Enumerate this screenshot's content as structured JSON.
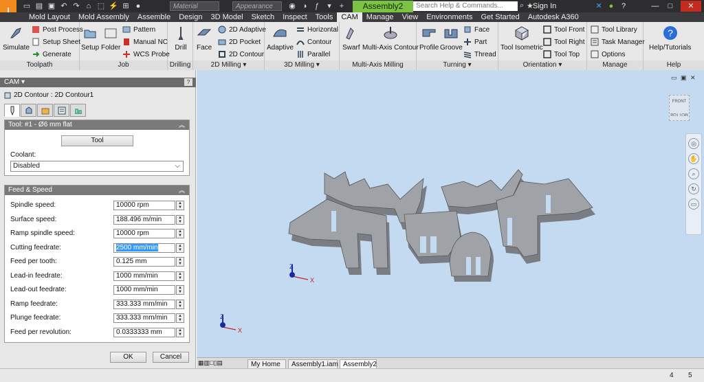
{
  "titlebar": {
    "material_placeholder": "Material",
    "appearance_placeholder": "Appearance",
    "doc_title": "Assembly2",
    "search_placeholder": "Search Help & Commands...",
    "signin": "Sign In",
    "logo_letter": "I",
    "logo_pro": "PRO"
  },
  "tabs": [
    "Mold Layout",
    "Mold Assembly",
    "Assemble",
    "Design",
    "3D Model",
    "Sketch",
    "Inspect",
    "Tools",
    "CAM",
    "Manage",
    "View",
    "Environments",
    "Get Started",
    "Autodesk A360"
  ],
  "active_tab": "CAM",
  "ribbon": {
    "toolpath": {
      "title": "Toolpath",
      "simulate": "Simulate",
      "post_process": "Post Process",
      "setup_sheet": "Setup Sheet",
      "generate": "Generate"
    },
    "job": {
      "title": "Job",
      "setup": "Setup",
      "folder": "Folder",
      "pattern": "Pattern",
      "manual_nc": "Manual NC",
      "wcs_probe": "WCS Probe"
    },
    "drilling": {
      "title": "Drilling",
      "drill": "Drill"
    },
    "milling2d": {
      "title": "2D Milling",
      "face": "Face",
      "adaptive2d": "2D Adaptive",
      "pocket2d": "2D Pocket",
      "contour2d": "2D Contour"
    },
    "milling3d": {
      "title": "3D Milling",
      "adaptive": "Adaptive",
      "horizontal": "Horizontal",
      "contour": "Contour",
      "parallel": "Parallel"
    },
    "multiaxis": {
      "title": "Multi-Axis Milling",
      "swarf": "Swarf",
      "multi_axis_contour": "Multi-Axis Contour"
    },
    "turning": {
      "title": "Turning",
      "profile": "Profile",
      "groove": "Groove",
      "face": "Face",
      "part": "Part",
      "thread": "Thread"
    },
    "orientation": {
      "title": "Orientation",
      "tool_isometric": "Tool Isometric",
      "tool_front": "Tool Front",
      "tool_right": "Tool Right",
      "tool_top": "Tool Top"
    },
    "manage": {
      "title": "Manage",
      "tool_library": "Tool Library",
      "task_manager": "Task Manager",
      "options": "Options"
    },
    "help": {
      "title": "Help",
      "help_tutorials": "Help/Tutorials"
    }
  },
  "cam_panel": {
    "header": "CAM",
    "subtitle": "2D Contour : 2D Contour1",
    "tool_section": "Tool: #1 - Ø6 mm flat",
    "tool_button": "Tool",
    "coolant_label": "Coolant:",
    "coolant_value": "Disabled",
    "feed_section": "Feed & Speed",
    "fields": [
      {
        "label": "Spindle speed:",
        "value": "10000 rpm"
      },
      {
        "label": "Surface speed:",
        "value": "188.496 m/min"
      },
      {
        "label": "Ramp spindle speed:",
        "value": "10000 rpm"
      },
      {
        "label": "Cutting feedrate:",
        "value": "2500 mm/min"
      },
      {
        "label": "Feed per tooth:",
        "value": "0.125 mm"
      },
      {
        "label": "Lead-in feedrate:",
        "value": "1000 mm/min"
      },
      {
        "label": "Lead-out feedrate:",
        "value": "1000 mm/min"
      },
      {
        "label": "Ramp feedrate:",
        "value": "333.333 mm/min"
      },
      {
        "label": "Plunge feedrate:",
        "value": "333.333 mm/min"
      },
      {
        "label": "Feed per revolution:",
        "value": "0.0333333 mm"
      }
    ],
    "ok": "OK",
    "cancel": "Cancel"
  },
  "viewcube": {
    "front": "FRONT",
    "bottom": "BOTTOM"
  },
  "axes": {
    "x": "X",
    "z": "Z"
  },
  "doc_tabs": [
    "My Home",
    "Assembly1.iam",
    "Assembly2"
  ],
  "active_doc_tab": "Assembly2",
  "status": {
    "left": "4",
    "right": "5"
  },
  "colors": {
    "cam_orange": "#f28a1e",
    "doc_green": "#7cc243",
    "viewport_bg": "#c3daf0",
    "part_fill": "#9fa3a8"
  }
}
